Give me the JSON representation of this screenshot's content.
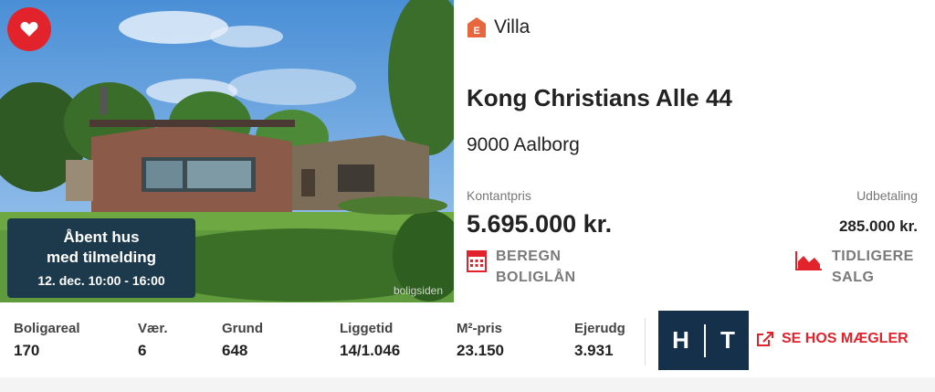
{
  "listing": {
    "property_type": "Villa",
    "energy_label": "E",
    "address": "Kong Christians Alle 44",
    "city": "9000 Aalborg",
    "cash_price_label": "Kontantpris",
    "cash_price": "5.695.000 kr.",
    "down_payment_label": "Udbetaling",
    "down_payment": "285.000 kr.",
    "open_house": {
      "line1": "Åbent hus",
      "line2": "med tilmelding",
      "time": "12. dec. 10:00 - 16:00"
    },
    "watermark": "boligsiden"
  },
  "actions": {
    "loan_line1": "BEREGN",
    "loan_line2": "BOLIGLÅN",
    "sales_line1": "TIDLIGERE",
    "sales_line2": "SALG",
    "broker": "SE HOS MÆGLER"
  },
  "stats": [
    {
      "label": "Boligareal",
      "value": "170"
    },
    {
      "label": "Vær.",
      "value": "6"
    },
    {
      "label": "Grund",
      "value": "648"
    },
    {
      "label": "Liggetid",
      "value": "14/1.046"
    },
    {
      "label": "M²-pris",
      "value": "23.150"
    },
    {
      "label": "Ejerudg",
      "value": "3.931"
    }
  ],
  "broker_logo": {
    "left": "H",
    "right": "T"
  },
  "colors": {
    "accent": "#e2232b",
    "navy": "#1d3a4c",
    "energy": "#e8663d"
  },
  "icons": {
    "favorite": "heart-icon",
    "energy": "energy-label-icon",
    "loan": "calculator-icon",
    "sales": "area-chart-icon",
    "broker": "open-external-icon"
  }
}
